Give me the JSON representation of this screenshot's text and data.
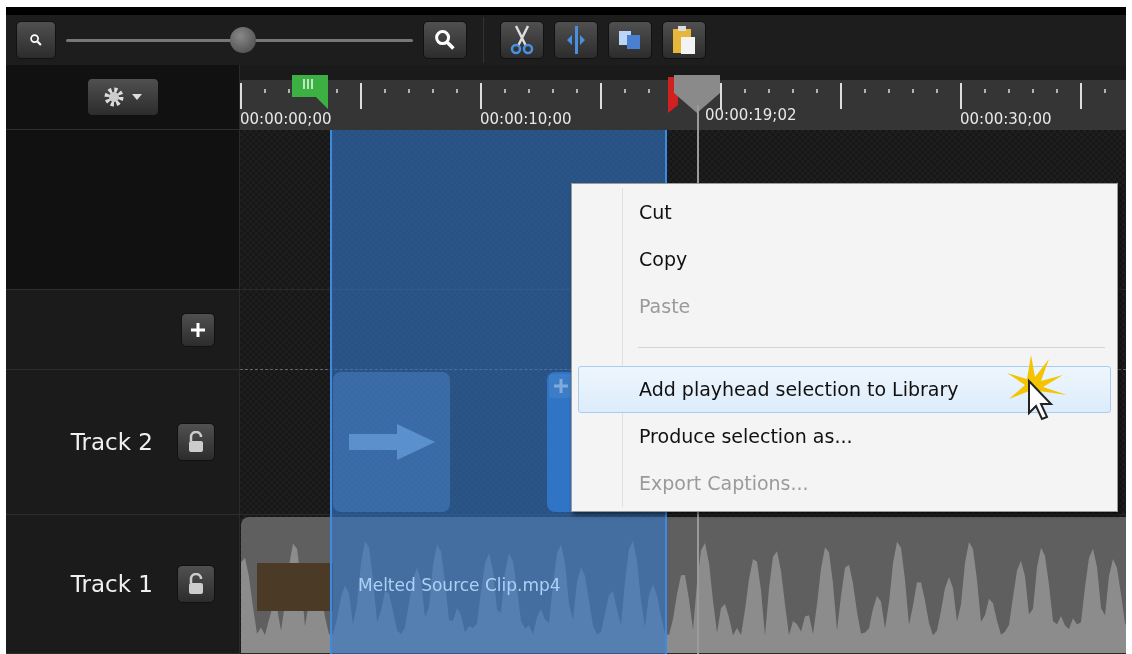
{
  "zoom_slider": {
    "level": 0.51
  },
  "ruler": {
    "labels": [
      "00:00:00;00",
      "00:00:10;00",
      "00:00:30;00"
    ],
    "playhead_time": "00:00:19;02"
  },
  "tracks": [
    {
      "name": "Track 2"
    },
    {
      "name": "Track 1"
    }
  ],
  "clip": {
    "name": "Melted Source Clip.mp4"
  },
  "context_menu": {
    "items": [
      {
        "kind": "item",
        "label": "Cut",
        "disabled": false,
        "selected": false
      },
      {
        "kind": "item",
        "label": "Copy",
        "disabled": false,
        "selected": false
      },
      {
        "kind": "item",
        "label": "Paste",
        "disabled": true,
        "selected": false
      },
      {
        "kind": "separator"
      },
      {
        "kind": "item",
        "label": "Add playhead selection to Library",
        "disabled": false,
        "selected": true
      },
      {
        "kind": "item",
        "label": "Produce selection as...",
        "disabled": false,
        "selected": false
      },
      {
        "kind": "item",
        "label": "Export Captions...",
        "disabled": true,
        "selected": false
      }
    ]
  }
}
